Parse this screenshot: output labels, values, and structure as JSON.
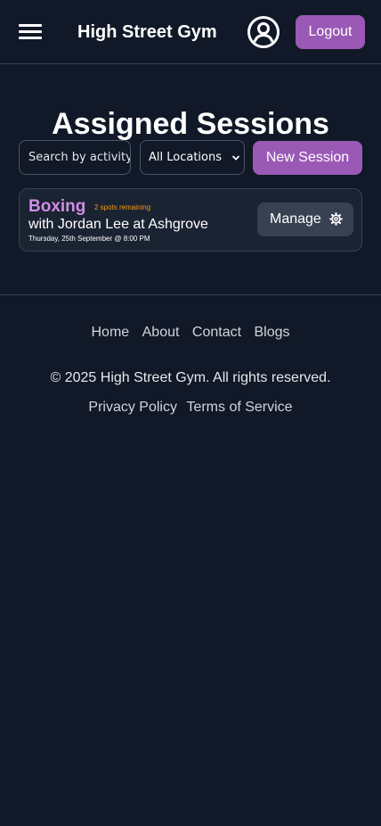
{
  "header": {
    "brand": "High Street Gym",
    "menu_icon": "hamburger-menu-icon",
    "profile_icon": "user-circle-icon",
    "logout_label": "Logout"
  },
  "main": {
    "title": "Assigned Sessions",
    "search": {
      "placeholder": "Search by activity",
      "value": ""
    },
    "location_filter": {
      "selected": "All Locations"
    },
    "new_session_label": "New Session",
    "sessions": [
      {
        "activity": "Boxing",
        "spots": "2 spots remaining",
        "trainer_location": "with Jordan Lee at Ashgrove",
        "datetime": "Thursday, 25th September @ 8:00 PM",
        "manage_label": "Manage",
        "manage_icon": "gear-icon"
      }
    ]
  },
  "footer": {
    "nav": [
      "Home",
      "About",
      "Contact",
      "Blogs"
    ],
    "copyright": "© 2025 High Street Gym. All rights reserved.",
    "legal": [
      "Privacy Policy",
      "Terms of Service"
    ]
  },
  "colors": {
    "background": "#111827",
    "accent": "#9b59b6",
    "activity": "#d08de6",
    "spots": "#f39c12",
    "card": "#1a2332"
  }
}
